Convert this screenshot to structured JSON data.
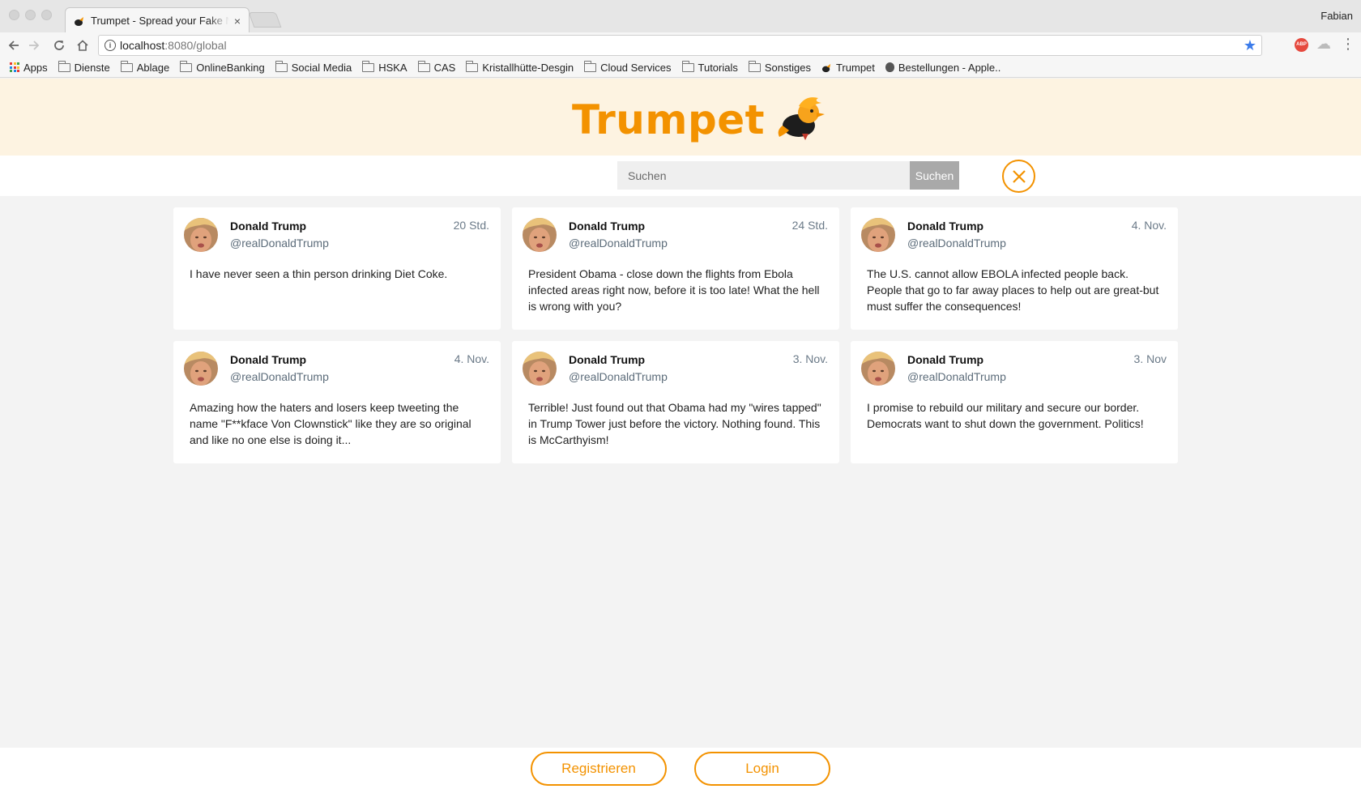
{
  "browser": {
    "tab_title": "Trumpet - Spread your Fake News",
    "tab_close": "×",
    "profile": "Fabian",
    "url_host": "localhost",
    "url_path": ":8080/global",
    "bookmarks": [
      {
        "label": "Apps",
        "icon": "apps-grid"
      },
      {
        "label": "Dienste",
        "icon": "folder"
      },
      {
        "label": "Ablage",
        "icon": "folder"
      },
      {
        "label": "OnlineBanking",
        "icon": "folder"
      },
      {
        "label": "Social Media",
        "icon": "folder"
      },
      {
        "label": "HSKA",
        "icon": "folder"
      },
      {
        "label": "CAS",
        "icon": "folder"
      },
      {
        "label": "Kristallhütte-Desgin",
        "icon": "folder"
      },
      {
        "label": "Cloud Services",
        "icon": "folder"
      },
      {
        "label": "Tutorials",
        "icon": "folder"
      },
      {
        "label": "Sonstiges",
        "icon": "folder"
      },
      {
        "label": "Trumpet",
        "icon": "trumpet-favicon"
      },
      {
        "label": "Bestellungen - Apple..",
        "icon": "apple"
      }
    ],
    "extension_abp": "ABP"
  },
  "site": {
    "logo_text": "Trumpet",
    "brand_color": "#f39200"
  },
  "search": {
    "placeholder": "Suchen",
    "button_label": "Suchen"
  },
  "posts": [
    {
      "name": "Donald Trump",
      "handle": "@realDonaldTrump",
      "time": "20 Std.",
      "text": "I have never seen a thin person drinking Diet Coke."
    },
    {
      "name": "Donald Trump",
      "handle": "@realDonaldTrump",
      "time": "24 Std.",
      "text": "President Obama - close down the flights from Ebola infected areas right now, before it is too late! What the hell is wrong with you?"
    },
    {
      "name": "Donald Trump",
      "handle": "@realDonaldTrump",
      "time": "4. Nov.",
      "text": "The U.S. cannot allow EBOLA infected people back. People that go to far away places to help out are great-but must suffer the consequences!"
    },
    {
      "name": "Donald Trump",
      "handle": "@realDonaldTrump",
      "time": "4. Nov.",
      "text": "Amazing how the haters and losers keep tweeting the name \"F**kface Von Clownstick\" like they are so original and like no one else is doing it..."
    },
    {
      "name": "Donald Trump",
      "handle": "@realDonaldTrump",
      "time": "3. Nov.",
      "text": "Terrible! Just found out that Obama had my \"wires tapped\" in Trump Tower just before the victory. Nothing found. This is McCarthyism!"
    },
    {
      "name": "Donald Trump",
      "handle": "@realDonaldTrump",
      "time": "3. Nov",
      "text": "I promise to rebuild our military and secure our border. Democrats want to shut down the government. Politics!"
    }
  ],
  "footer": {
    "register_label": "Registrieren",
    "login_label": "Login"
  }
}
